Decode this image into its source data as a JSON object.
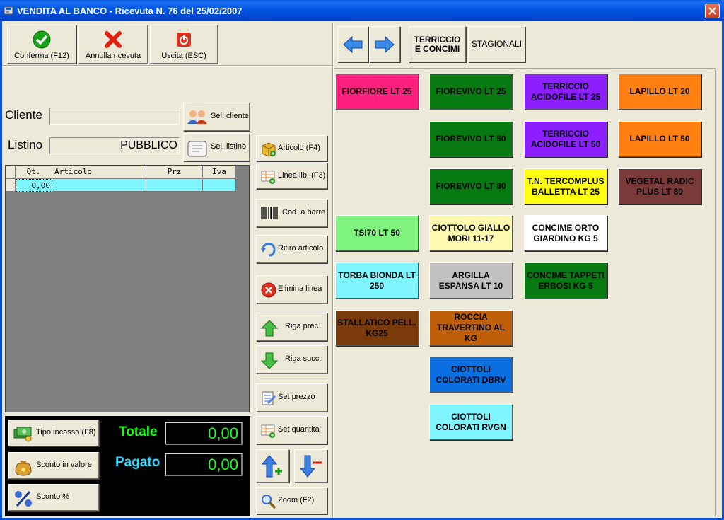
{
  "window": {
    "title": "VENDITA AL BANCO - Ricevuta N. 76 del 25/02/2007"
  },
  "toolbar": {
    "confirm_label": "Conferma (F12)",
    "cancel_label": "Annulla ricevuta",
    "exit_label": "Uscita (ESC)"
  },
  "customer": {
    "cliente_label": "Cliente",
    "cliente_value": "",
    "listino_label": "Listino",
    "listino_value": "PUBBLICO",
    "sel_cliente_label": "Sel. cliente",
    "sel_listino_label": "Sel. listino"
  },
  "grid": {
    "headers": [
      "",
      "Qt.",
      "Articolo",
      "Prz",
      "Iva"
    ],
    "rows": [
      {
        "qty": "0,00",
        "articolo": "",
        "prz": "",
        "iva": ""
      }
    ]
  },
  "actions": {
    "articolo": "Articolo (F4)",
    "linea_lib": "Linea lib. (F3)",
    "cod_barre": "Cod. a barre",
    "ritiro": "Ritiro articolo",
    "elimina": "Elimina linea",
    "riga_prec": "Riga prec.",
    "riga_succ": "Riga succ.",
    "set_prezzo": "Set prezzo",
    "set_quantita": "Set quantita'",
    "zoom": "Zoom (F2)"
  },
  "payment": {
    "tipo_incasso": "Tipo incasso (F8)",
    "sconto_valore": "Sconto in valore",
    "sconto_perc": "Sconto %",
    "totale_label": "Totale",
    "totale_value": "0,00",
    "pagato_label": "Pagato",
    "pagato_value": "0,00"
  },
  "categories": {
    "terriccio": "TERRICCIO\nE CONCIMI",
    "stagionali": "STAGIONALI"
  },
  "products": [
    {
      "label": "FIORFIORE LT 25",
      "bg": "#ff1f7f",
      "fg": "#000000"
    },
    {
      "label": "FIOREVIVO LT 25",
      "bg": "#067a10",
      "fg": "#000000"
    },
    {
      "label": "TERRICCIO ACIDOFILE LT 25",
      "bg": "#8c1fff",
      "fg": "#000000"
    },
    {
      "label": "LAPILLO LT 20",
      "bg": "#ff7f10",
      "fg": "#000000"
    },
    {
      "label": "FIOREVIVO LT 50",
      "bg": "#067a10",
      "fg": "#000000"
    },
    {
      "label": "TERRICCIO ACIDOFILE LT 50",
      "bg": "#8c1fff",
      "fg": "#000000"
    },
    {
      "label": "LAPILLO LT 50",
      "bg": "#ff7f10",
      "fg": "#000000"
    },
    {
      "label": "FIOREVIVO LT 80",
      "bg": "#067a10",
      "fg": "#000000"
    },
    {
      "label": "T.N. TERCOMPLUS BALLETTA LT 25",
      "bg": "#ffff10",
      "fg": "#000000"
    },
    {
      "label": "VEGETAL RADIC PLUS LT 80",
      "bg": "#7a3a3a",
      "fg": "#000000"
    },
    {
      "label": "TSI70 LT 50",
      "bg": "#7ff57f",
      "fg": "#000000"
    },
    {
      "label": "CIOTTOLO GIALLO MORI 11-17",
      "bg": "#fffab0",
      "fg": "#000000"
    },
    {
      "label": "CONCIME ORTO GIARDINO KG 5",
      "bg": "#ffffff",
      "fg": "#000000"
    },
    {
      "label": "TORBA BIONDA LT 250",
      "bg": "#7ff5ff",
      "fg": "#000000"
    },
    {
      "label": "ARGILLA ESPANSA LT 10",
      "bg": "#c0c0c0",
      "fg": "#000000"
    },
    {
      "label": "CONCIME TAPPETI ERBOSI KG 5",
      "bg": "#067a10",
      "fg": "#000000"
    },
    {
      "label": "STALLATICO PELL. KG25",
      "bg": "#7a3a0a",
      "fg": "#000000"
    },
    {
      "label": "ROCCIA TRAVERTINO AL KG",
      "bg": "#c05f0a",
      "fg": "#000000"
    },
    {
      "label": "CIOTTOLI COLORATI DBRV",
      "bg": "#0a6fe0",
      "fg": "#000000"
    },
    {
      "label": "CIOTTOLI COLORATI RVGN",
      "bg": "#7ff5ff",
      "fg": "#000000"
    }
  ]
}
